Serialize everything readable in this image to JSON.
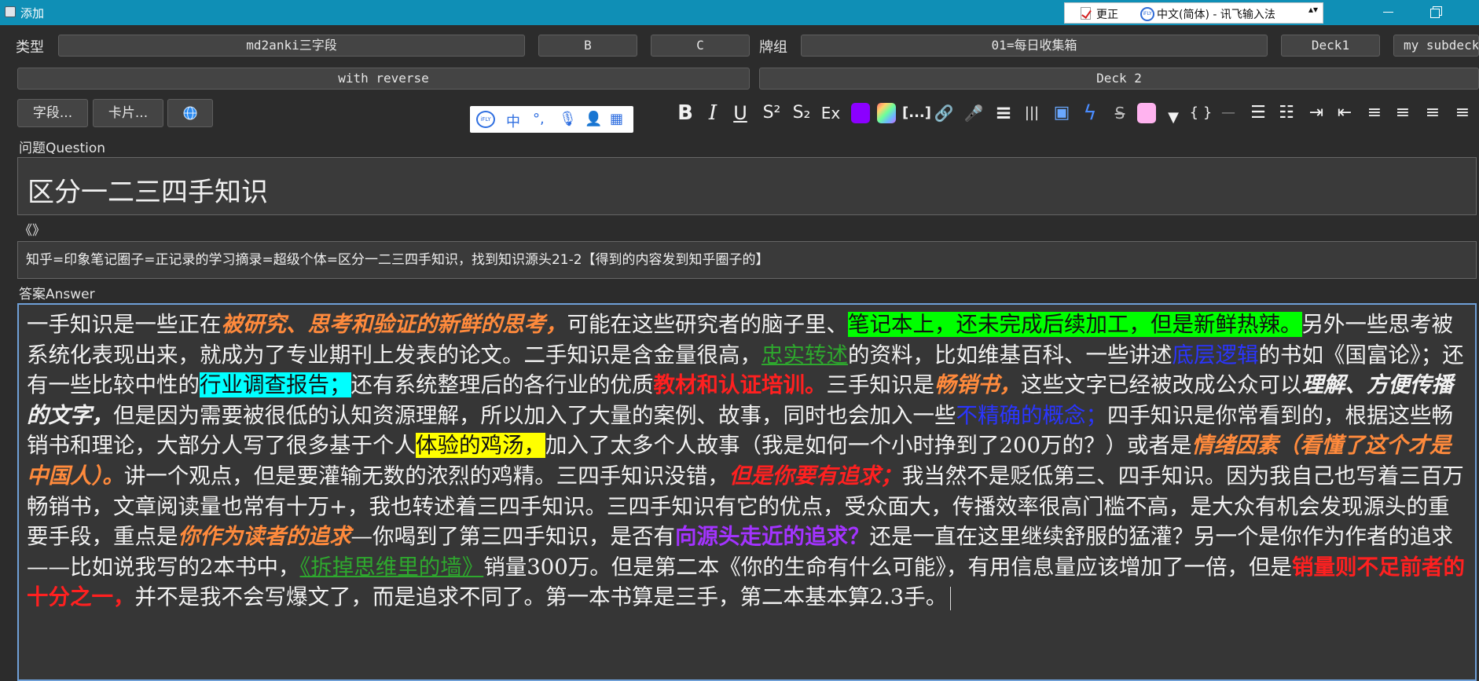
{
  "window": {
    "title": "添加",
    "ime": {
      "correct": "更正",
      "logo": "iFLY",
      "status": "中文(简体) - 讯飞输入法",
      "arrows": "▴▾"
    }
  },
  "row1": {
    "type_label": "类型",
    "type_value": "md2anki三字段",
    "btn_b": "B",
    "btn_c": "C",
    "deck_label": "牌组",
    "deck_value": "01=每日收集箱",
    "deck1": "Deck1",
    "subdeck": "my subdeck"
  },
  "row2": {
    "reverse": "with reverse",
    "deck2": "Deck 2"
  },
  "row3": {
    "fields_btn": "字段...",
    "cards_btn": "卡片..."
  },
  "ime_mini": {
    "logo": "iFLY",
    "zh": "中"
  },
  "toolbar": {
    "bold": "B",
    "italic": "I",
    "underline": "U",
    "superscript": "S²",
    "subscript": "S₂",
    "clear": "Ex",
    "cloze": "[...]",
    "link": "🔗",
    "mic": "🎤",
    "list": "≡",
    "columns": "|||",
    "image": "▣",
    "flash": "ϟ",
    "strike": "S",
    "dropdown": "▼",
    "code": "{ }",
    "hr": "—",
    "ul": "☰",
    "ol": "☷",
    "indent": "⇥",
    "outdent": "⇤",
    "center": "≡",
    "left": "≡",
    "right": "≡",
    "justify": "≡"
  },
  "fields": {
    "question_label": "问题Question",
    "question_text": "区分一二三四手知识",
    "remark_label": "《》",
    "remark_text": "知乎=印象笔记圈子=正记录的学习摘录=超级个体=区分一二三四手知识，找到知识源头21-2【得到的内容发到知乎圈子的】",
    "answer_label": "答案Answer"
  },
  "answer": [
    {
      "t": "一手知识是一些正在"
    },
    {
      "t": "被研究、思考和验证的新鲜的思考，",
      "c": "it c-orange"
    },
    {
      "t": "可能在这些研究者的脑子里、"
    },
    {
      "t": "笔记本上，还未完成后续加工，但是新鲜热辣。",
      "c": "hl-green"
    },
    {
      "t": "另外一些思考被系统化表现出来，就成为了专业期刊上发表的论文。二手知识是含金量很高，"
    },
    {
      "t": "忠实转述",
      "c": "c-green ul"
    },
    {
      "t": "的资料，比如维基百科、一些讲述"
    },
    {
      "t": "底层逻辑",
      "c": "c-blue"
    },
    {
      "t": "的书如《国富论》；还有一些比较中性的"
    },
    {
      "t": "行业调查报告；",
      "c": "hl-cyan"
    },
    {
      "t": "还有系统整理后的各行业的优质"
    },
    {
      "t": "教材和认证培训。",
      "c": "c-red bold"
    },
    {
      "t": "三手知识是"
    },
    {
      "t": "畅销书，",
      "c": "it c-orange"
    },
    {
      "t": "这些文字已经被改成公众可以"
    },
    {
      "t": "理解、方便传播的文字，",
      "c": "it"
    },
    {
      "t": "但是因为需要被很低的认知资源理解，所以加入了大量的案例、故事，同时也会加入一些"
    },
    {
      "t": "不精确的概念；",
      "c": "c-blue"
    },
    {
      "t": "四手知识是你常看到的，根据这些畅销书和理论，大部分人写了很多基于个人"
    },
    {
      "t": "体验的鸡汤，",
      "c": "hl-yellow"
    },
    {
      "t": "加入了太多个人故事（我是如何一个小时挣到了200万的？）或者是"
    },
    {
      "t": "情绪因素（看懂了这个才是中国人）。",
      "c": "it c-orange"
    },
    {
      "t": "讲一个观点，但是要灌输无数的浓烈的鸡精。三四手知识没错，"
    },
    {
      "t": "但是你要有追求；",
      "c": "it c-red"
    },
    {
      "t": "我当然不是贬低第三、四手知识。因为我自己也写着三百万畅销书，文章阅读量也常有十万+，我也转述着三四手知识。三四手知识有它的优点，受众面大，传播效率很高门槛不高，是大众有机会发现源头的重要手段，重点是"
    },
    {
      "t": "你作为读者的追求",
      "c": "it c-orange"
    },
    {
      "t": "—你喝到了第三四手知识，是否有"
    },
    {
      "t": "向源头走近的追求？",
      "c": "c-purple bold"
    },
    {
      "t": "还是一直在这里继续舒服的猛灌？另一个是你作为作者的追求——比如说我写的2本书中，"
    },
    {
      "t": "《拆掉思维里的墙》",
      "c": "c-green ul"
    },
    {
      "t": "销量300万。但是第二本《你的生命有什么可能》，有用信息量应该增加了一倍，但是"
    },
    {
      "t": "销量则不足前者的十分之一，",
      "c": "c-red bold"
    },
    {
      "t": "并不是我不会写爆文了，而是追求不同了。第一本书算是三手，第二本基本算2.3手。"
    }
  ]
}
